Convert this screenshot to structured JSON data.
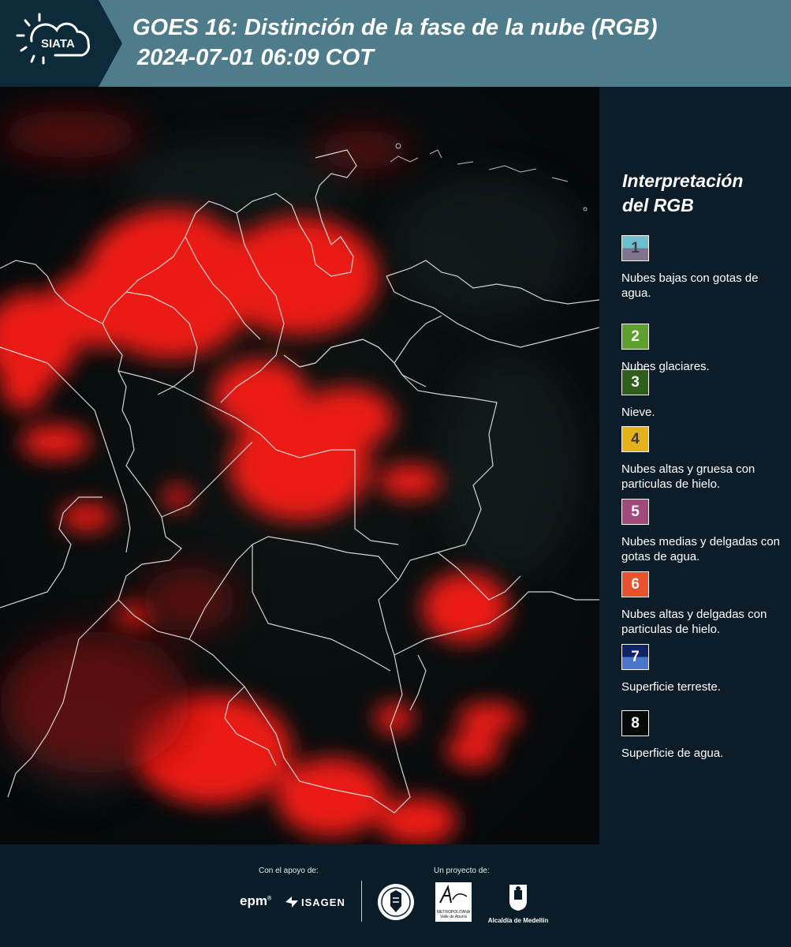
{
  "header": {
    "logo_text": "SIATA",
    "title_line1": "GOES 16: Distinción de la fase de la nube (RGB)",
    "title_line2": "2024-07-01 06:09 COT"
  },
  "legend": {
    "title_line1": "Interpretación",
    "title_line2": "del RGB",
    "items": [
      {
        "number": "1",
        "label": "Nubes bajas con gotas de agua.",
        "color_top": "#6cbfcc",
        "color_bottom": "#7f7490",
        "text_color": "#3a3f4a"
      },
      {
        "number": "2",
        "label": "Nubes glaciares.",
        "color_top": "#5f9f2e",
        "color_bottom": "#5f9f2e",
        "text_color": "#ffffff"
      },
      {
        "number": "3",
        "label": "Nieve.",
        "color_top": "#2f5d1c",
        "color_bottom": "#2f5d1c",
        "text_color": "#ffffff"
      },
      {
        "number": "4",
        "label": "Nubes altas y gruesa con particulas de hielo.",
        "color_top": "#e5b21a",
        "color_bottom": "#e5b21a",
        "text_color": "#3a3a3a"
      },
      {
        "number": "5",
        "label": "Nubes medias y delgadas con gotas de agua.",
        "color_top": "#a24a7c",
        "color_bottom": "#a24a7c",
        "text_color": "#ffffff"
      },
      {
        "number": "6",
        "label": "Nubes altas y delgadas con particulas de hielo.",
        "color_top": "#e8502e",
        "color_bottom": "#e8502e",
        "text_color": "#ffffff"
      },
      {
        "number": "7",
        "label": "Superficie terreste.",
        "color_top": "#0f2366",
        "color_bottom": "#4a75c8",
        "text_color": "#ffffff"
      },
      {
        "number": "8",
        "label": "Superficie de agua.",
        "color_top": "#040a08",
        "color_bottom": "#040a08",
        "text_color": "#ffffff"
      }
    ]
  },
  "footer": {
    "support_label": "Con el apoyo de:",
    "project_label": "Un proyecto de:",
    "sponsor1": "epm",
    "sponsor2": "ISAGEN",
    "partner1": "METROPOLITANA",
    "partner1_sub": "Valle de Aburrá",
    "partner2": "Alcaldía de Medellín"
  }
}
